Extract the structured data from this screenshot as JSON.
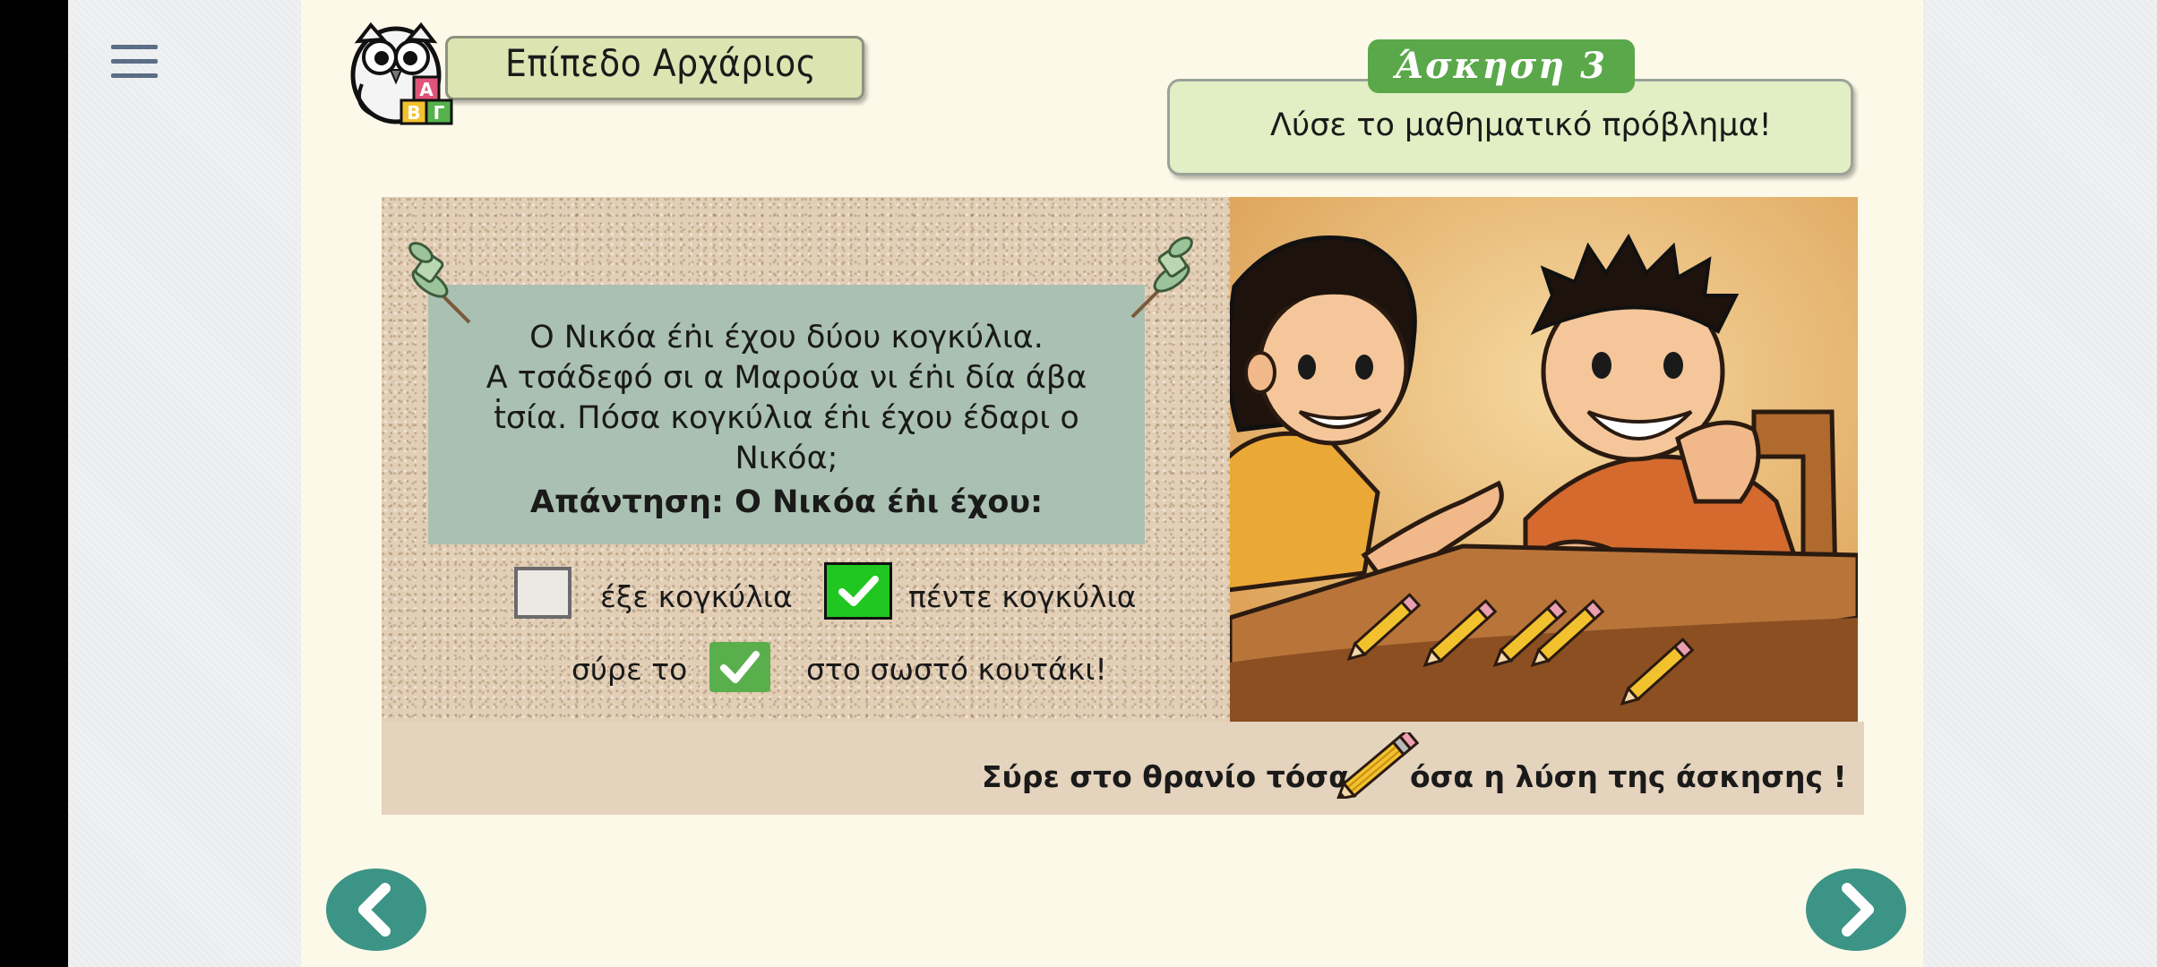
{
  "header": {
    "level_label": "Επίπεδο Αρχάριος",
    "exercise_label": "Άσκηση 3",
    "instruction": "Λύσε το μαθηματικό πρόβλημα!"
  },
  "question": {
    "lines": [
      "Ο Νικόα έṅι έχου δύου κογκύλια.",
      "Α τσάδεφό σι α Μαρούα νι έṅι δία άβα",
      "ṫσία. Πόσα κογκύλια έṅι έχου έδαρι ο",
      "Νικόα;"
    ],
    "answer": "Απάντηση: Ο Νικόα έṅι έχου:"
  },
  "options": [
    {
      "label": "έξε κογκύλια",
      "checked": false
    },
    {
      "label": "πέντε κογκύλια",
      "checked": true
    }
  ],
  "drag_hint": {
    "before": "σύρε το",
    "after": "στο σωστό κουτάκι!"
  },
  "caption": {
    "before": "Σύρε στο θρανίο τόσα",
    "after": "όσα η λύση της άσκησης !"
  },
  "icons": {
    "menu": "hamburger-icon",
    "prev": "chevron-left-icon",
    "next": "chevron-right-icon",
    "check": "checkmark-icon",
    "pencil": "pencil-icon",
    "mascot": "owl-mascot"
  },
  "colors": {
    "accent_green": "#5aa84a",
    "nav_teal": "#3c9486",
    "checked_green": "#21c721"
  }
}
